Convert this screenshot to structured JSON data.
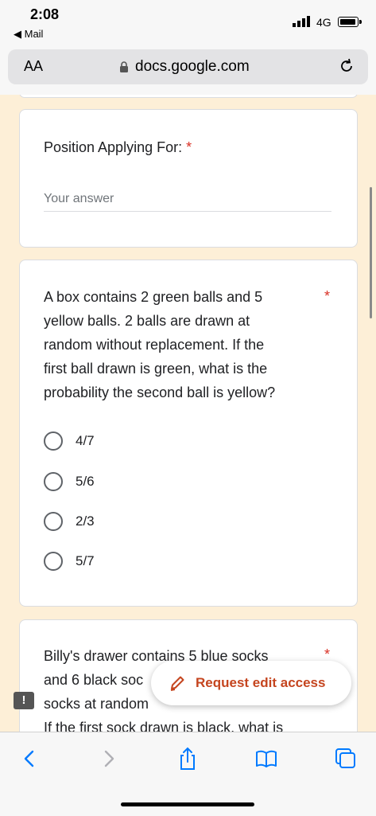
{
  "status": {
    "time": "2:08",
    "back_app": "◀ Mail",
    "network": "4G"
  },
  "address_bar": {
    "text_size_label": "AA",
    "url": "docs.google.com"
  },
  "form": {
    "question1": {
      "title": "Position Applying For:",
      "required": "*",
      "placeholder": "Your answer"
    },
    "question2": {
      "lines": [
        "A box contains 2 green balls and 5",
        "yellow balls. 2 balls are drawn at",
        "random without replacement. If the",
        "first ball drawn is green, what is the",
        "probability the second ball is yellow?"
      ],
      "required": "*",
      "options": [
        "4/7",
        "5/6",
        "2/3",
        "5/7"
      ]
    },
    "question3": {
      "lines": [
        "Billy's drawer contains 5 blue socks",
        "and 6 black soc",
        "socks at random",
        "If the first sock drawn is black, what is"
      ],
      "required": "*"
    }
  },
  "request_edit": {
    "label": "Request edit access"
  },
  "feedback_flag": "!"
}
